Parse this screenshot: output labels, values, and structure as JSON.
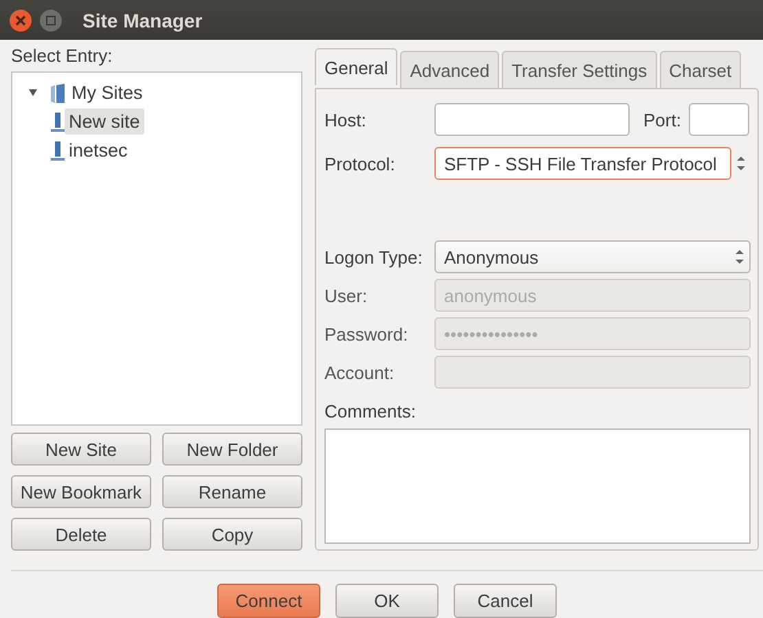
{
  "window": {
    "title": "Site Manager"
  },
  "entry_label": "Select Entry:",
  "tree": [
    {
      "label": "My Sites",
      "kind": "folder",
      "expanded": true,
      "selected": false,
      "children": [
        {
          "label": "New site",
          "kind": "site",
          "selected": true
        },
        {
          "label": "inetsec",
          "kind": "site",
          "selected": false
        }
      ]
    }
  ],
  "entry_buttons": [
    "New Site",
    "New Folder",
    "New Bookmark",
    "Rename",
    "Delete",
    "Copy"
  ],
  "tabs": [
    {
      "label": "General",
      "selected": true
    },
    {
      "label": "Advanced",
      "selected": false
    },
    {
      "label": "Transfer Settings",
      "selected": false
    },
    {
      "label": "Charset",
      "selected": false
    }
  ],
  "host": {
    "label": "Host:",
    "port_label": "Port:"
  },
  "protocol": {
    "label": "Protocol:",
    "value": "SFTP - SSH File Transfer Protocol",
    "focused": true
  },
  "logon_type": {
    "label": "Logon Type:",
    "value": "Anonymous",
    "focused": false
  },
  "credentials": [
    {
      "label": "User:",
      "value": "anonymous",
      "disabled": true
    },
    {
      "label": "Password:",
      "value": "•••••••••••••••",
      "disabled": true
    },
    {
      "label": "Account:",
      "disabled": true
    }
  ],
  "comments": {
    "label": "Comments:"
  },
  "dialog_buttons": [
    {
      "label": "Connect",
      "highlighted": true
    },
    {
      "label": "OK",
      "highlighted": false
    },
    {
      "label": "Cancel",
      "highlighted": false
    }
  ]
}
